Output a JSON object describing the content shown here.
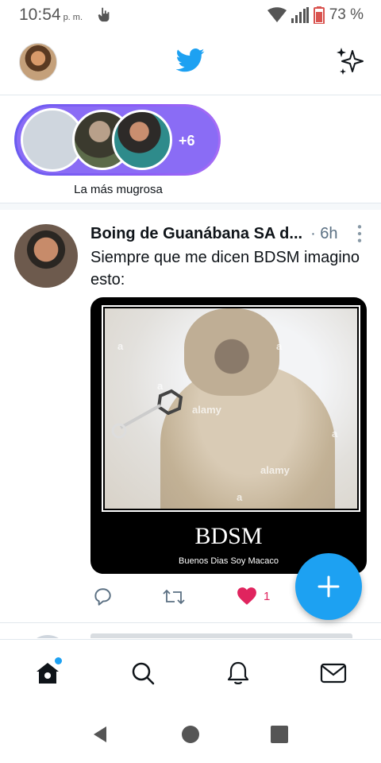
{
  "status_bar": {
    "time": "10:54",
    "ampm": "p. m.",
    "battery_percent": "73 %",
    "icons": [
      "gesture-icon",
      "wifi-icon",
      "signal-icon",
      "battery-icon"
    ]
  },
  "header": {
    "logo_icon": "twitter-bird-icon",
    "sparkle_icon": "sparkle-icon"
  },
  "fleets": {
    "more_count": "+6",
    "label": "La más mugrosa"
  },
  "tweet": {
    "author_name": "Boing de Guanábana SA d...",
    "time": "· 6h",
    "text": "Siempre que me dicen BDSM imagino esto:",
    "media": {
      "watermark": "alamy",
      "watermark_letter": "a",
      "caption_big": "BDSM",
      "caption_small": "Buenos Dias Soy Macaco"
    },
    "actions": {
      "like_count": "1"
    }
  },
  "colors": {
    "accent": "#1da1f2",
    "like": "#e0245e",
    "fleet_gradient": "#8b5cf6"
  },
  "bottom_nav": [
    "home-icon",
    "search-icon",
    "notifications-icon",
    "messages-icon"
  ]
}
